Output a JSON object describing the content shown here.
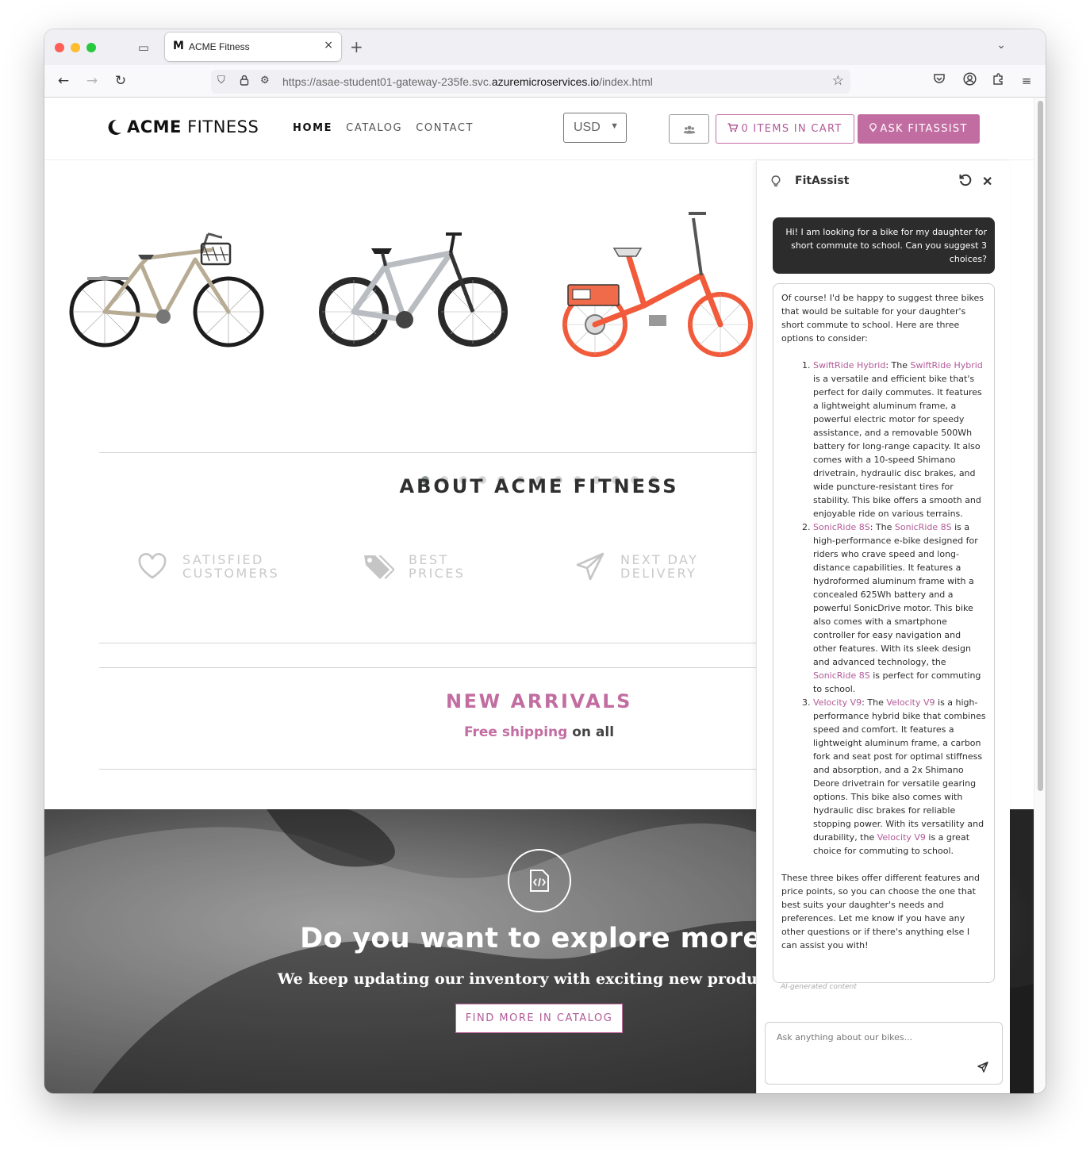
{
  "browser": {
    "tab_favicon": "M",
    "tab_title": "ACME Fitness",
    "tab_close": "×",
    "new_tab": "+",
    "url_prefix": "https://asae-student01-gateway-235fe.svc.",
    "url_host": "azuremicroservices.io",
    "url_path": "/index.html"
  },
  "header": {
    "logo_bold": "ACME",
    "logo_rest": " FITNESS",
    "nav": [
      {
        "label": "HOME",
        "active": true
      },
      {
        "label": "CATALOG",
        "active": false
      },
      {
        "label": "CONTACT",
        "active": false
      }
    ],
    "currency": "USD",
    "cart_label": "0 ITEMS IN CART",
    "ask_label": "ASK FITASSIST"
  },
  "carousel": {
    "slide_count": 13,
    "active_index": 0,
    "products": [
      "city-bike",
      "mountain-bike",
      "folding-e-bike"
    ]
  },
  "about": {
    "title": "ABOUT ACME FITNESS",
    "features": [
      {
        "icon": "heart-icon",
        "line1": "SATISFIED",
        "line2": "CUSTOMERS"
      },
      {
        "icon": "tags-icon",
        "line1": "BEST",
        "line2": "PRICES"
      },
      {
        "icon": "paper-plane-icon",
        "line1": "NEXT DAY",
        "line2": "DELIVERY"
      }
    ]
  },
  "arrivals": {
    "title": "NEW ARRIVALS",
    "sub_highlight": "Free shipping",
    "sub_rest": " on all"
  },
  "banner": {
    "title": "Do you want to explore more?",
    "subtitle": "We keep updating our inventory with exciting new products !!",
    "button": "FIND MORE IN CATALOG"
  },
  "chat": {
    "title": "FitAssist",
    "user_message": "Hi! I am looking for a bike for my daughter for short commute to school. Can you suggest 3 choices?",
    "intro": "Of course! I'd be happy to suggest three bikes that would be suitable for your daughter's short commute to school. Here are three options to consider:",
    "items": [
      {
        "name": "SwiftRide Hybrid",
        "sep": ": The ",
        "name2": "SwiftRide Hybrid",
        "text": " is a versatile and efficient bike that's perfect for daily commutes. It features a lightweight aluminum frame, a powerful electric motor for speedy assistance, and a removable 500Wh battery for long-range capacity. It also comes with a 10-speed Shimano drivetrain, hydraulic disc brakes, and wide puncture-resistant tires for stability. This bike offers a smooth and enjoyable ride on various terrains.",
        "name3": "",
        "tail": ""
      },
      {
        "name": "SonicRide 8S",
        "sep": ": The ",
        "name2": "SonicRide 8S",
        "text": " is a high-performance e-bike designed for riders who crave speed and long-distance capabilities. It features a hydroformed aluminum frame with a concealed 625Wh battery and a powerful SonicDrive motor. This bike also comes with a smartphone controller for easy navigation and other features. With its sleek design and advanced technology, the ",
        "name3": "SonicRide 8S",
        "tail": " is perfect for commuting to school."
      },
      {
        "name": "Velocity V9",
        "sep": ": The ",
        "name2": "Velocity V9",
        "text": " is a high-performance hybrid bike that combines speed and comfort. It features a lightweight aluminum frame, a carbon fork and seat post for optimal stiffness and absorption, and a 2x Shimano Deore drivetrain for versatile gearing options. This bike also comes with hydraulic disc brakes for reliable stopping power. With its versatility and durability, the ",
        "name3": "Velocity V9",
        "tail": " is a great choice for commuting to school."
      }
    ],
    "outro": "These three bikes offer different features and price points, so you can choose the one that best suits your daughter's needs and preferences. Let me know if you have any other questions or if there's anything else I can assist you with!",
    "ai_note": "AI-generated content",
    "input_placeholder": "Ask anything about our bikes..."
  },
  "colors": {
    "accent": "#c26da1",
    "dark_bubble": "#2c2c2c"
  }
}
